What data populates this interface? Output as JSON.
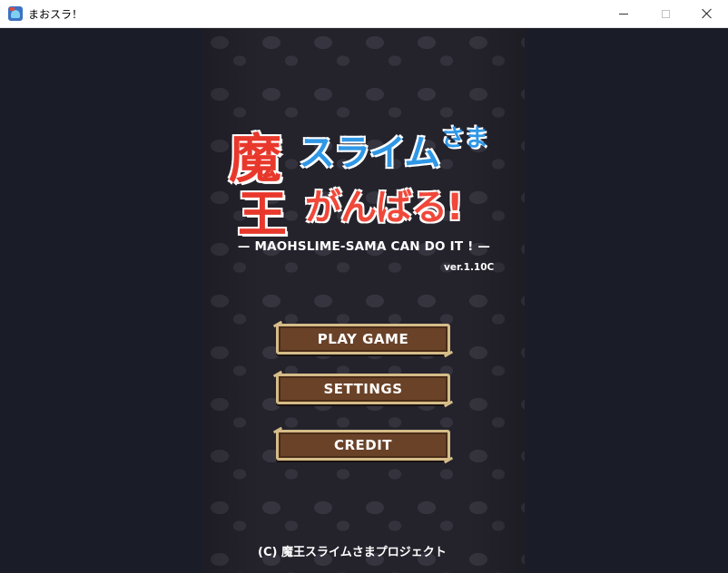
{
  "window": {
    "title": "まおスラ！",
    "icon": "game-app-icon"
  },
  "logo": {
    "kanji_top": "魔",
    "kanji_bottom": "王",
    "line1": "スライム",
    "line1_suffix": "さま",
    "line2": "がんばる!",
    "subtitle": "— MAOHSLIME-SAMA CAN DO IT ! —",
    "version": "ver.1.10C"
  },
  "menu": {
    "play": "PLAY GAME",
    "settings": "SETTINGS",
    "credit": "CREDIT"
  },
  "footer": {
    "copyright": "(C) 魔王スライムさまプロジェクト"
  },
  "colors": {
    "button_wood": "#6a4228",
    "button_border": "#d5bc88",
    "logo_blue": "#2f97e6",
    "logo_red": "#e8382c",
    "background": "#1a1d27"
  }
}
